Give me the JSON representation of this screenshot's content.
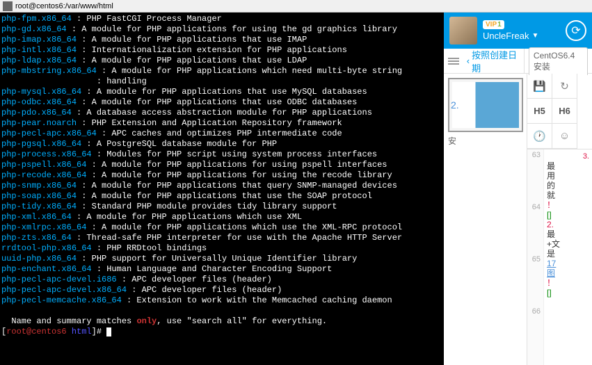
{
  "title_bar": {
    "text": "root@centos6:/var/www/html"
  },
  "terminal": {
    "lines": [
      {
        "pkg": "php-fpm.x86_64",
        "desc": "PHP FastCGI Process Manager"
      },
      {
        "pkg": "php-gd.x86_64",
        "desc": "A module for PHP applications for using the gd graphics library"
      },
      {
        "pkg": "php-imap.x86_64",
        "desc": "A module for PHP applications that use IMAP"
      },
      {
        "pkg": "php-intl.x86_64",
        "desc": "Internationalization extension for PHP applications"
      },
      {
        "pkg": "php-ldap.x86_64",
        "desc": "A module for PHP applications that use LDAP"
      },
      {
        "pkg": "php-mbstring.x86_64",
        "desc": "A module for PHP applications which need multi-byte string\n                   : handling"
      },
      {
        "pkg": "php-mysql.x86_64",
        "desc": "A module for PHP applications that use MySQL databases"
      },
      {
        "pkg": "php-odbc.x86_64",
        "desc": "A module for PHP applications that use ODBC databases"
      },
      {
        "pkg": "php-pdo.x86_64",
        "desc": "A database access abstraction module for PHP applications"
      },
      {
        "pkg": "php-pear.noarch",
        "desc": "PHP Extension and Application Repository framework"
      },
      {
        "pkg": "php-pecl-apc.x86_64",
        "desc": "APC caches and optimizes PHP intermediate code"
      },
      {
        "pkg": "php-pgsql.x86_64",
        "desc": "A PostgreSQL database module for PHP"
      },
      {
        "pkg": "php-process.x86_64",
        "desc": "Modules for PHP script using system process interfaces"
      },
      {
        "pkg": "php-pspell.x86_64",
        "desc": "A module for PHP applications for using pspell interfaces"
      },
      {
        "pkg": "php-recode.x86_64",
        "desc": "A module for PHP applications for using the recode library"
      },
      {
        "pkg": "php-snmp.x86_64",
        "desc": "A module for PHP applications that query SNMP-managed devices"
      },
      {
        "pkg": "php-soap.x86_64",
        "desc": "A module for PHP applications that use the SOAP protocol"
      },
      {
        "pkg": "php-tidy.x86_64",
        "desc": "Standard PHP module provides tidy library support"
      },
      {
        "pkg": "php-xml.x86_64",
        "desc": "A module for PHP applications which use XML"
      },
      {
        "pkg": "php-xmlrpc.x86_64",
        "desc": "A module for PHP applications which use the XML-RPC protocol"
      },
      {
        "pkg": "php-zts.x86_64",
        "desc": "Thread-safe PHP interpreter for use with the Apache HTTP Server"
      },
      {
        "pkg": "rrdtool-php.x86_64",
        "desc": "PHP RRDtool bindings"
      },
      {
        "pkg": "uuid-php.x86_64",
        "desc": "PHP support for Universally Unique Identifier library"
      },
      {
        "pkg": "php-enchant.x86_64",
        "desc": "Human Language and Character Encoding Support"
      },
      {
        "pkg": "php-pecl-apc-devel.i686",
        "desc": "APC developer files (header)"
      },
      {
        "pkg": "php-pecl-apc-devel.x86_64",
        "desc": "APC developer files (header)"
      },
      {
        "pkg": "php-pecl-memcache.x86_64",
        "desc": "Extension to work with the Memcached caching daemon"
      }
    ],
    "footer": {
      "prefix": "  Name and summary matches ",
      "highlight": "only",
      "suffix": ", use \"search all\" for everything."
    },
    "prompt": {
      "user": "root@centos6",
      "path": "html"
    }
  },
  "user_header": {
    "vip_label": "VIP",
    "vip_num": "1",
    "username": "UncleFreak"
  },
  "toolbar": {
    "breadcrumb_label": "按照创建日期",
    "tab_label": "CentOS6.4安装"
  },
  "preview": {
    "num": "2.",
    "label": "安"
  },
  "editor_tools": {
    "save": "💾",
    "redo": "↻",
    "h5": "H5",
    "h6": "H6",
    "clock": "🕐",
    "emoji": "☺"
  },
  "gutter": [
    "63",
    "64",
    "65",
    "66"
  ],
  "code_lines": [
    {
      "type": "red-inline",
      "text": "3."
    },
    {
      "type": "zh",
      "text": "最"
    },
    {
      "type": "zh",
      "text": "用"
    },
    {
      "type": "zh",
      "text": "的"
    },
    {
      "type": "zh",
      "text": "就"
    },
    {
      "type": "red",
      "text": "！"
    },
    {
      "type": "green",
      "text": "[]"
    },
    {
      "type": "red",
      "text": "2."
    },
    {
      "type": "zh",
      "text": "最"
    },
    {
      "type": "zh",
      "text": "+文"
    },
    {
      "type": "zh",
      "text": "是"
    },
    {
      "type": "blue",
      "text": "17"
    },
    {
      "type": "blue",
      "text": "图"
    },
    {
      "type": "red",
      "text": "！"
    },
    {
      "type": "green",
      "text": "[]"
    }
  ]
}
